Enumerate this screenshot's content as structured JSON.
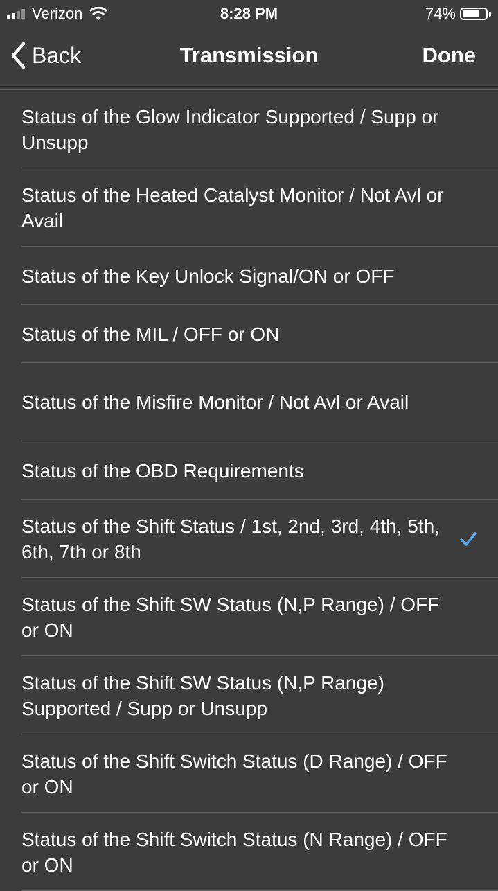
{
  "status_bar": {
    "carrier": "Verizon",
    "time": "8:28 PM",
    "battery": "74%",
    "battery_level": 0.74
  },
  "nav": {
    "back_label": "Back",
    "title": "Transmission",
    "done_label": "Done"
  },
  "list": {
    "items": [
      {
        "label": "Status of the Glow Indicator Supported / Supp or Unsupp",
        "checked": false
      },
      {
        "label": "Status of the Heated Catalyst Monitor / Not Avl or Avail",
        "checked": false
      },
      {
        "label": "Status of the Key Unlock Signal/ON or OFF",
        "checked": false
      },
      {
        "label": "Status of the MIL / OFF or ON",
        "checked": false
      },
      {
        "label": "Status of the Misfire Monitor / Not Avl or Avail",
        "checked": false
      },
      {
        "label": "Status of the OBD Requirements",
        "checked": false
      },
      {
        "label": "Status of the Shift Status / 1st, 2nd, 3rd, 4th, 5th, 6th, 7th or 8th",
        "checked": true
      },
      {
        "label": "Status of the Shift SW Status (N,P Range) / OFF or ON",
        "checked": false
      },
      {
        "label": "Status of the Shift SW Status (N,P Range) Supported / Supp or Unsupp",
        "checked": false
      },
      {
        "label": "Status of the Shift Switch Status (D Range) / OFF or ON",
        "checked": false
      },
      {
        "label": "Status of the Shift Switch Status (N Range) / OFF or ON",
        "checked": false
      }
    ]
  },
  "colors": {
    "background": "#3c3c3c",
    "separator": "#5a5a5a",
    "check": "#5aa9f0"
  }
}
